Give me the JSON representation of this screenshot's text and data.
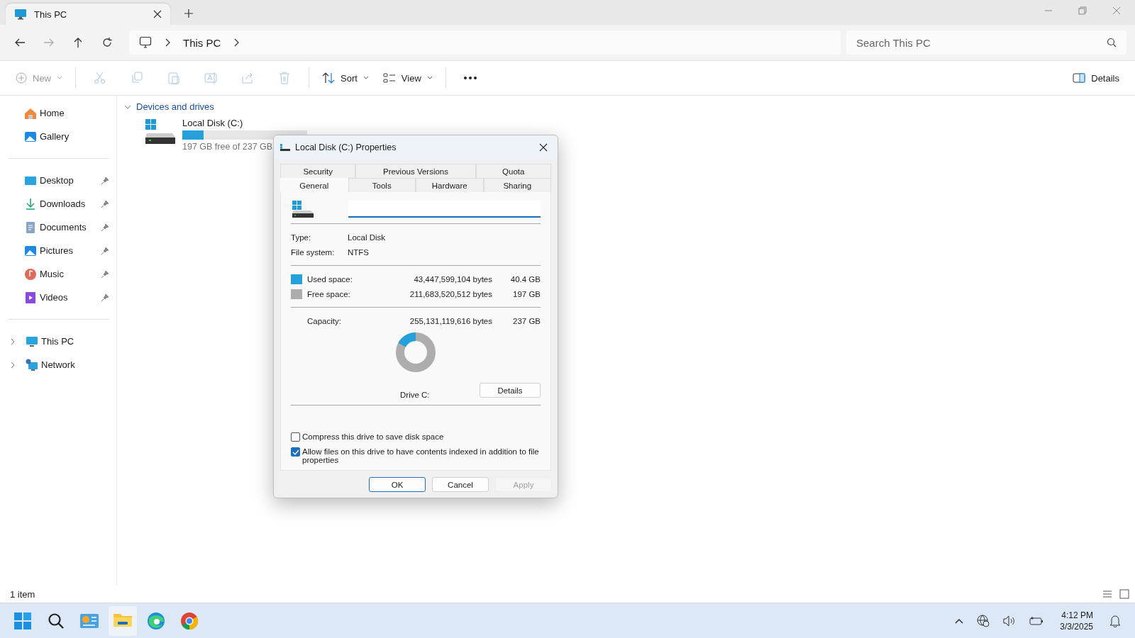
{
  "tabs": [
    {
      "title": "This PC",
      "selected": true
    }
  ],
  "address": {
    "path": "This PC"
  },
  "search": {
    "placeholder": "Search This PC"
  },
  "toolbar": {
    "new": "New",
    "actions": [
      {
        "kind": "cut",
        "disabled": true
      },
      {
        "kind": "copy",
        "disabled": true
      },
      {
        "kind": "paste",
        "disabled": true
      },
      {
        "kind": "rename",
        "disabled": true
      },
      {
        "kind": "share",
        "disabled": true
      },
      {
        "kind": "delete",
        "disabled": true
      }
    ],
    "sort": "Sort",
    "view": "View",
    "details": "Details"
  },
  "sidebar": {
    "quick": [
      {
        "label": "Home",
        "kind": "home"
      },
      {
        "label": "Gallery",
        "kind": "gallery"
      }
    ],
    "pinned": [
      {
        "label": "Desktop",
        "kind": "desktop",
        "pinned": true
      },
      {
        "label": "Downloads",
        "kind": "downloads",
        "pinned": true
      },
      {
        "label": "Documents",
        "kind": "documents",
        "pinned": true
      },
      {
        "label": "Pictures",
        "kind": "pictures",
        "pinned": true
      },
      {
        "label": "Music",
        "kind": "music",
        "pinned": true
      },
      {
        "label": "Videos",
        "kind": "videos",
        "pinned": true
      }
    ],
    "tree": [
      {
        "label": "This PC",
        "kind": "pc",
        "expanded": false
      },
      {
        "label": "Network",
        "kind": "network",
        "expanded": false
      }
    ]
  },
  "section": {
    "title": "Devices and drives",
    "expanded": true
  },
  "drives": [
    {
      "name": "Local Disk (C:)",
      "level": 0.17,
      "info": "197 GB free of 237 GB"
    }
  ],
  "status_bar": {
    "count": "1 item"
  },
  "dialog": {
    "title": "Local Disk (C:) Properties",
    "tab_rows": [
      [
        {
          "label": "Security",
          "selected": false
        },
        {
          "label": "Previous Versions",
          "selected": false
        },
        {
          "label": "Quota",
          "selected": false
        }
      ],
      [
        {
          "label": "General",
          "selected": true
        },
        {
          "label": "Tools",
          "selected": false
        },
        {
          "label": "Hardware",
          "selected": false
        },
        {
          "label": "Sharing",
          "selected": false
        }
      ]
    ],
    "fields": [
      {
        "label": "Type:",
        "value": "Local Disk"
      },
      {
        "label": "File system:",
        "value": "NTFS"
      }
    ],
    "space": [
      {
        "label": "Used space:",
        "bytes": "43,447,599,104 bytes",
        "size": "40.4 GB",
        "color": "#26a0da"
      },
      {
        "label": "Free space:",
        "bytes": "211,683,520,512 bytes",
        "size": "197 GB",
        "color": "#adadad"
      }
    ],
    "capacity": {
      "label": "Capacity:",
      "bytes": "255,131,119,616 bytes",
      "size": "237 GB"
    },
    "drive_label": "Drive C:",
    "details_button": "Details",
    "options": [
      {
        "label": "Compress this drive to save disk space",
        "checked": false
      },
      {
        "label": "Allow files on this drive to have contents indexed in addition to file properties",
        "checked": true
      }
    ],
    "buttons": [
      {
        "label": "OK",
        "kind": "default",
        "disabled": false
      },
      {
        "label": "Cancel",
        "kind": "normal",
        "disabled": false
      },
      {
        "label": "Apply",
        "kind": "normal",
        "disabled": true
      }
    ]
  },
  "taskbar": {
    "apps": [
      {
        "kind": "start",
        "selected": false
      },
      {
        "kind": "search",
        "selected": false
      },
      {
        "kind": "widgets",
        "selected": false
      },
      {
        "kind": "files",
        "selected": true
      },
      {
        "kind": "edge",
        "selected": false
      },
      {
        "kind": "chrome",
        "selected": false
      }
    ],
    "time": "4:12 PM",
    "date": "3/3/2025"
  }
}
